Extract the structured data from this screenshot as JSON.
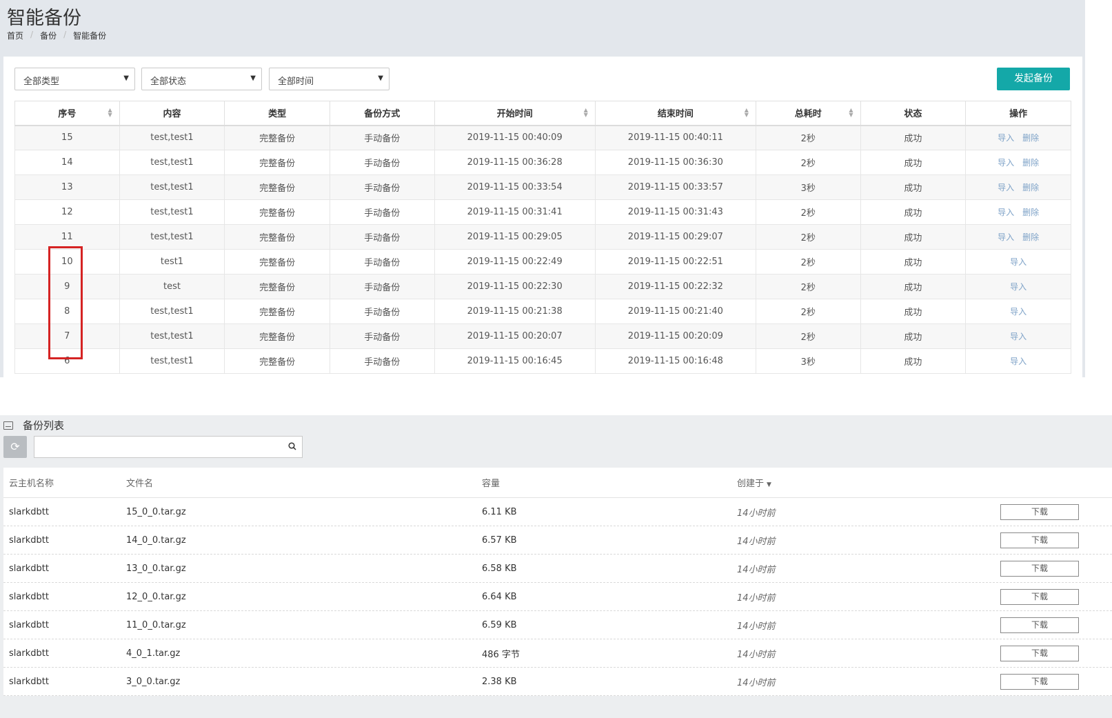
{
  "page": {
    "title": "智能备份",
    "breadcrumb": [
      "首页",
      "备份",
      "智能备份"
    ]
  },
  "filters": {
    "type": "全部类型",
    "status": "全部状态",
    "time": "全部时间"
  },
  "start_backup_label": "发起备份",
  "table": {
    "headers": [
      "序号",
      "内容",
      "类型",
      "备份方式",
      "开始时间",
      "结束时间",
      "总耗时",
      "状态",
      "操作"
    ],
    "import_label": "导入",
    "delete_label": "删除",
    "rows": [
      {
        "id": "15",
        "content": "test,test1",
        "type": "完整备份",
        "method": "手动备份",
        "start": "2019-11-15 00:40:09",
        "end": "2019-11-15 00:40:11",
        "duration": "2秒",
        "status": "成功",
        "can_delete": true
      },
      {
        "id": "14",
        "content": "test,test1",
        "type": "完整备份",
        "method": "手动备份",
        "start": "2019-11-15 00:36:28",
        "end": "2019-11-15 00:36:30",
        "duration": "2秒",
        "status": "成功",
        "can_delete": true
      },
      {
        "id": "13",
        "content": "test,test1",
        "type": "完整备份",
        "method": "手动备份",
        "start": "2019-11-15 00:33:54",
        "end": "2019-11-15 00:33:57",
        "duration": "3秒",
        "status": "成功",
        "can_delete": true
      },
      {
        "id": "12",
        "content": "test,test1",
        "type": "完整备份",
        "method": "手动备份",
        "start": "2019-11-15 00:31:41",
        "end": "2019-11-15 00:31:43",
        "duration": "2秒",
        "status": "成功",
        "can_delete": true
      },
      {
        "id": "11",
        "content": "test,test1",
        "type": "完整备份",
        "method": "手动备份",
        "start": "2019-11-15 00:29:05",
        "end": "2019-11-15 00:29:07",
        "duration": "2秒",
        "status": "成功",
        "can_delete": true
      },
      {
        "id": "10",
        "content": "test1",
        "type": "完整备份",
        "method": "手动备份",
        "start": "2019-11-15 00:22:49",
        "end": "2019-11-15 00:22:51",
        "duration": "2秒",
        "status": "成功",
        "can_delete": false
      },
      {
        "id": "9",
        "content": "test",
        "type": "完整备份",
        "method": "手动备份",
        "start": "2019-11-15 00:22:30",
        "end": "2019-11-15 00:22:32",
        "duration": "2秒",
        "status": "成功",
        "can_delete": false
      },
      {
        "id": "8",
        "content": "test,test1",
        "type": "完整备份",
        "method": "手动备份",
        "start": "2019-11-15 00:21:38",
        "end": "2019-11-15 00:21:40",
        "duration": "2秒",
        "status": "成功",
        "can_delete": false
      },
      {
        "id": "7",
        "content": "test,test1",
        "type": "完整备份",
        "method": "手动备份",
        "start": "2019-11-15 00:20:07",
        "end": "2019-11-15 00:20:09",
        "duration": "2秒",
        "status": "成功",
        "can_delete": false
      },
      {
        "id": "6",
        "content": "test,test1",
        "type": "完整备份",
        "method": "手动备份",
        "start": "2019-11-15 00:16:45",
        "end": "2019-11-15 00:16:48",
        "duration": "3秒",
        "status": "成功",
        "can_delete": false
      }
    ]
  },
  "backup_list": {
    "title": "备份列表",
    "search_value": "",
    "headers": [
      "云主机名称",
      "文件名",
      "容量",
      "创建于"
    ],
    "download_label": "下载",
    "rows": [
      {
        "host": "slarkdbtt",
        "file": "15_0_0.tar.gz",
        "size": "6.11 KB",
        "created": "14小时前"
      },
      {
        "host": "slarkdbtt",
        "file": "14_0_0.tar.gz",
        "size": "6.57 KB",
        "created": "14小时前"
      },
      {
        "host": "slarkdbtt",
        "file": "13_0_0.tar.gz",
        "size": "6.58 KB",
        "created": "14小时前"
      },
      {
        "host": "slarkdbtt",
        "file": "12_0_0.tar.gz",
        "size": "6.64 KB",
        "created": "14小时前"
      },
      {
        "host": "slarkdbtt",
        "file": "11_0_0.tar.gz",
        "size": "6.59 KB",
        "created": "14小时前"
      },
      {
        "host": "slarkdbtt",
        "file": "4_0_1.tar.gz",
        "size": "486 字节",
        "created": "14小时前"
      },
      {
        "host": "slarkdbtt",
        "file": "3_0_0.tar.gz",
        "size": "2.38 KB",
        "created": "14小时前"
      }
    ]
  },
  "colors": {
    "accent": "#14a8a8",
    "link": "#7fa3c8",
    "highlight": "#d52323"
  }
}
